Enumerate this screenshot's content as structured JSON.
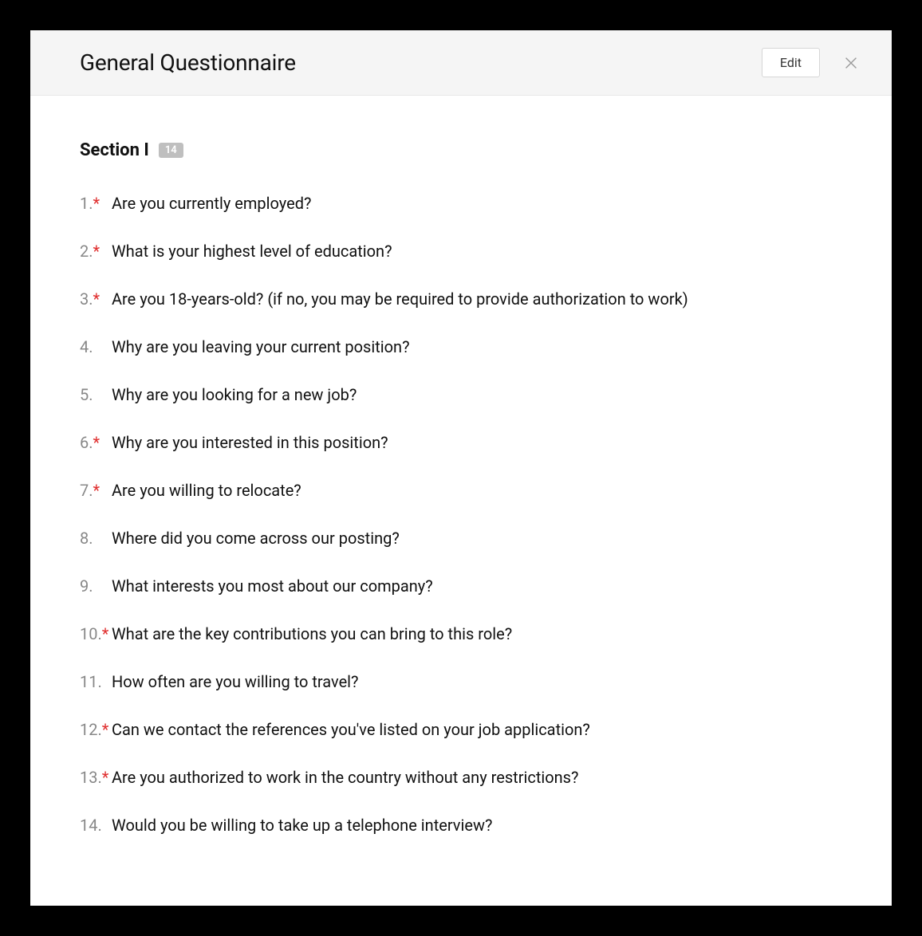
{
  "header": {
    "title": "General Questionnaire",
    "edit_label": "Edit"
  },
  "section": {
    "title": "Section I",
    "count": "14",
    "questions": [
      {
        "n": "1.",
        "required": true,
        "text": "Are you currently employed?"
      },
      {
        "n": "2.",
        "required": true,
        "text": "What is your highest level of education?"
      },
      {
        "n": "3.",
        "required": true,
        "text": "Are you 18-years-old? (if no, you may be required to provide authorization to work)"
      },
      {
        "n": "4.",
        "required": false,
        "text": "Why are you leaving your current position?"
      },
      {
        "n": "5.",
        "required": false,
        "text": "Why are you looking for a new job?"
      },
      {
        "n": "6.",
        "required": true,
        "text": "Why are you interested in this position?"
      },
      {
        "n": "7.",
        "required": true,
        "text": "Are you willing to relocate?"
      },
      {
        "n": "8.",
        "required": false,
        "text": "Where did you come across our posting?"
      },
      {
        "n": "9.",
        "required": false,
        "text": "What interests you most about our company?"
      },
      {
        "n": "10.",
        "required": true,
        "text": "What are the key contributions you can bring to this role?"
      },
      {
        "n": "11.",
        "required": false,
        "text": "How often are you willing to travel?"
      },
      {
        "n": "12.",
        "required": true,
        "text": "Can we contact the references you've listed on your job application?"
      },
      {
        "n": "13.",
        "required": true,
        "text": "Are you authorized to work in the country without any restrictions?"
      },
      {
        "n": "14.",
        "required": false,
        "text": "Would you be willing to take up a telephone interview?"
      }
    ]
  }
}
